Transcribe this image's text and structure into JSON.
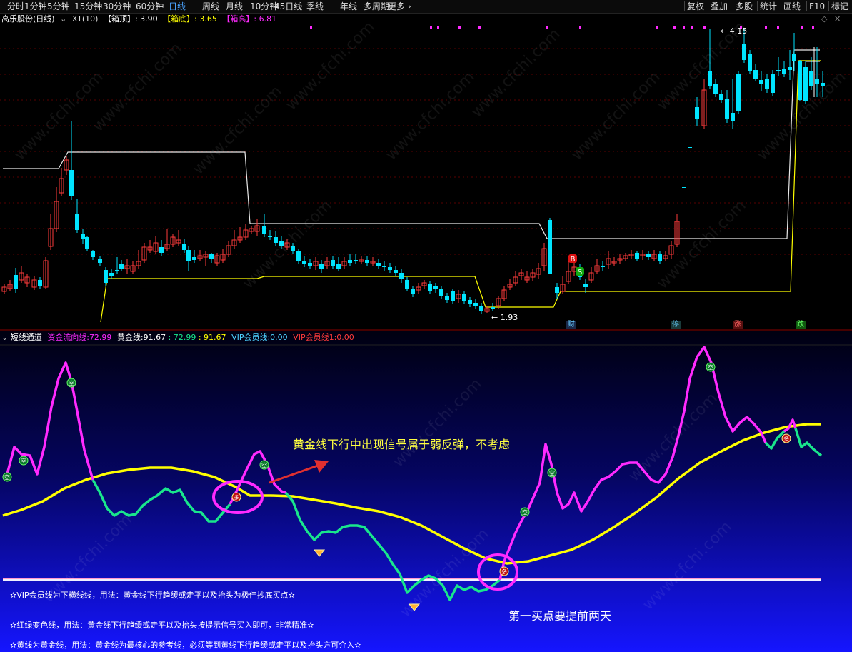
{
  "toolbar": {
    "left_items": [
      "分时",
      "1分钟",
      "5分钟",
      "15分钟",
      "30分钟",
      "60分钟",
      "日线",
      "周线",
      "月线",
      "10分钟",
      "45日线",
      "季线",
      "年线",
      "多周期",
      "更多 ›"
    ],
    "active": "日线",
    "right_items": [
      "复权",
      "叠加",
      "多股",
      "统计",
      "画线",
      "F10",
      "标记"
    ]
  },
  "main_header": {
    "stock": "高乐股份(日线)",
    "xt": "XT(10)",
    "box_top_label": "【箱顶】",
    "box_top_value": ": 3.90",
    "box_bottom_label": "【箱底】",
    "box_bottom_value": ": 3.65",
    "box_high_label": "【箱高】",
    "box_high_value": ": 6.81"
  },
  "price_labels": {
    "high": "4.15",
    "low": "1.93"
  },
  "event_badges": [
    "财",
    "停",
    "涨",
    "跌"
  ],
  "signal_badges": {
    "buy": "B",
    "sell": "S"
  },
  "indicator_header": {
    "name": "短线通道",
    "fund_line_label": "资金流向线:",
    "fund_line_value": "72.99",
    "gold_line_label": "黄金线:",
    "gold_line_value": "91.67",
    "v1": ": 72.99",
    "v2": ": 91.67",
    "vip_label": "VIP会员线:",
    "vip_value": "0.00",
    "vip1_label": "VIP会员线1:",
    "vip1_value": "0.00"
  },
  "annotations": {
    "weak_rebound": "黄金线下行中出现信号属于弱反弹，不考虑",
    "first_buy": "第一买点要提前两天"
  },
  "notes": [
    "✫VIP会员线为下横线线，用法：黄金线下行趋缓或走平以及抬头为极佳抄底买点✫",
    "✫红绿变色线，用法：黄金线下行趋缓或走平以及抬头按提示信号买入即可，非常精准✫",
    "✫黄线为黄金线，用法：黄金线为最核心的参考线，必须等到黄线下行趋缓或走平以及抬头方可介入✫"
  ],
  "signal_marks": {
    "empty": "空",
    "long": "多"
  },
  "watermark": "www.cfchi.com",
  "colors": {
    "up": "#ff3b3b",
    "down": "#00e5ff",
    "fund_up": "#ff2aff",
    "fund_down": "#19e68c",
    "gold": "#ffff00",
    "active_tab": "#4aa3ff"
  }
}
